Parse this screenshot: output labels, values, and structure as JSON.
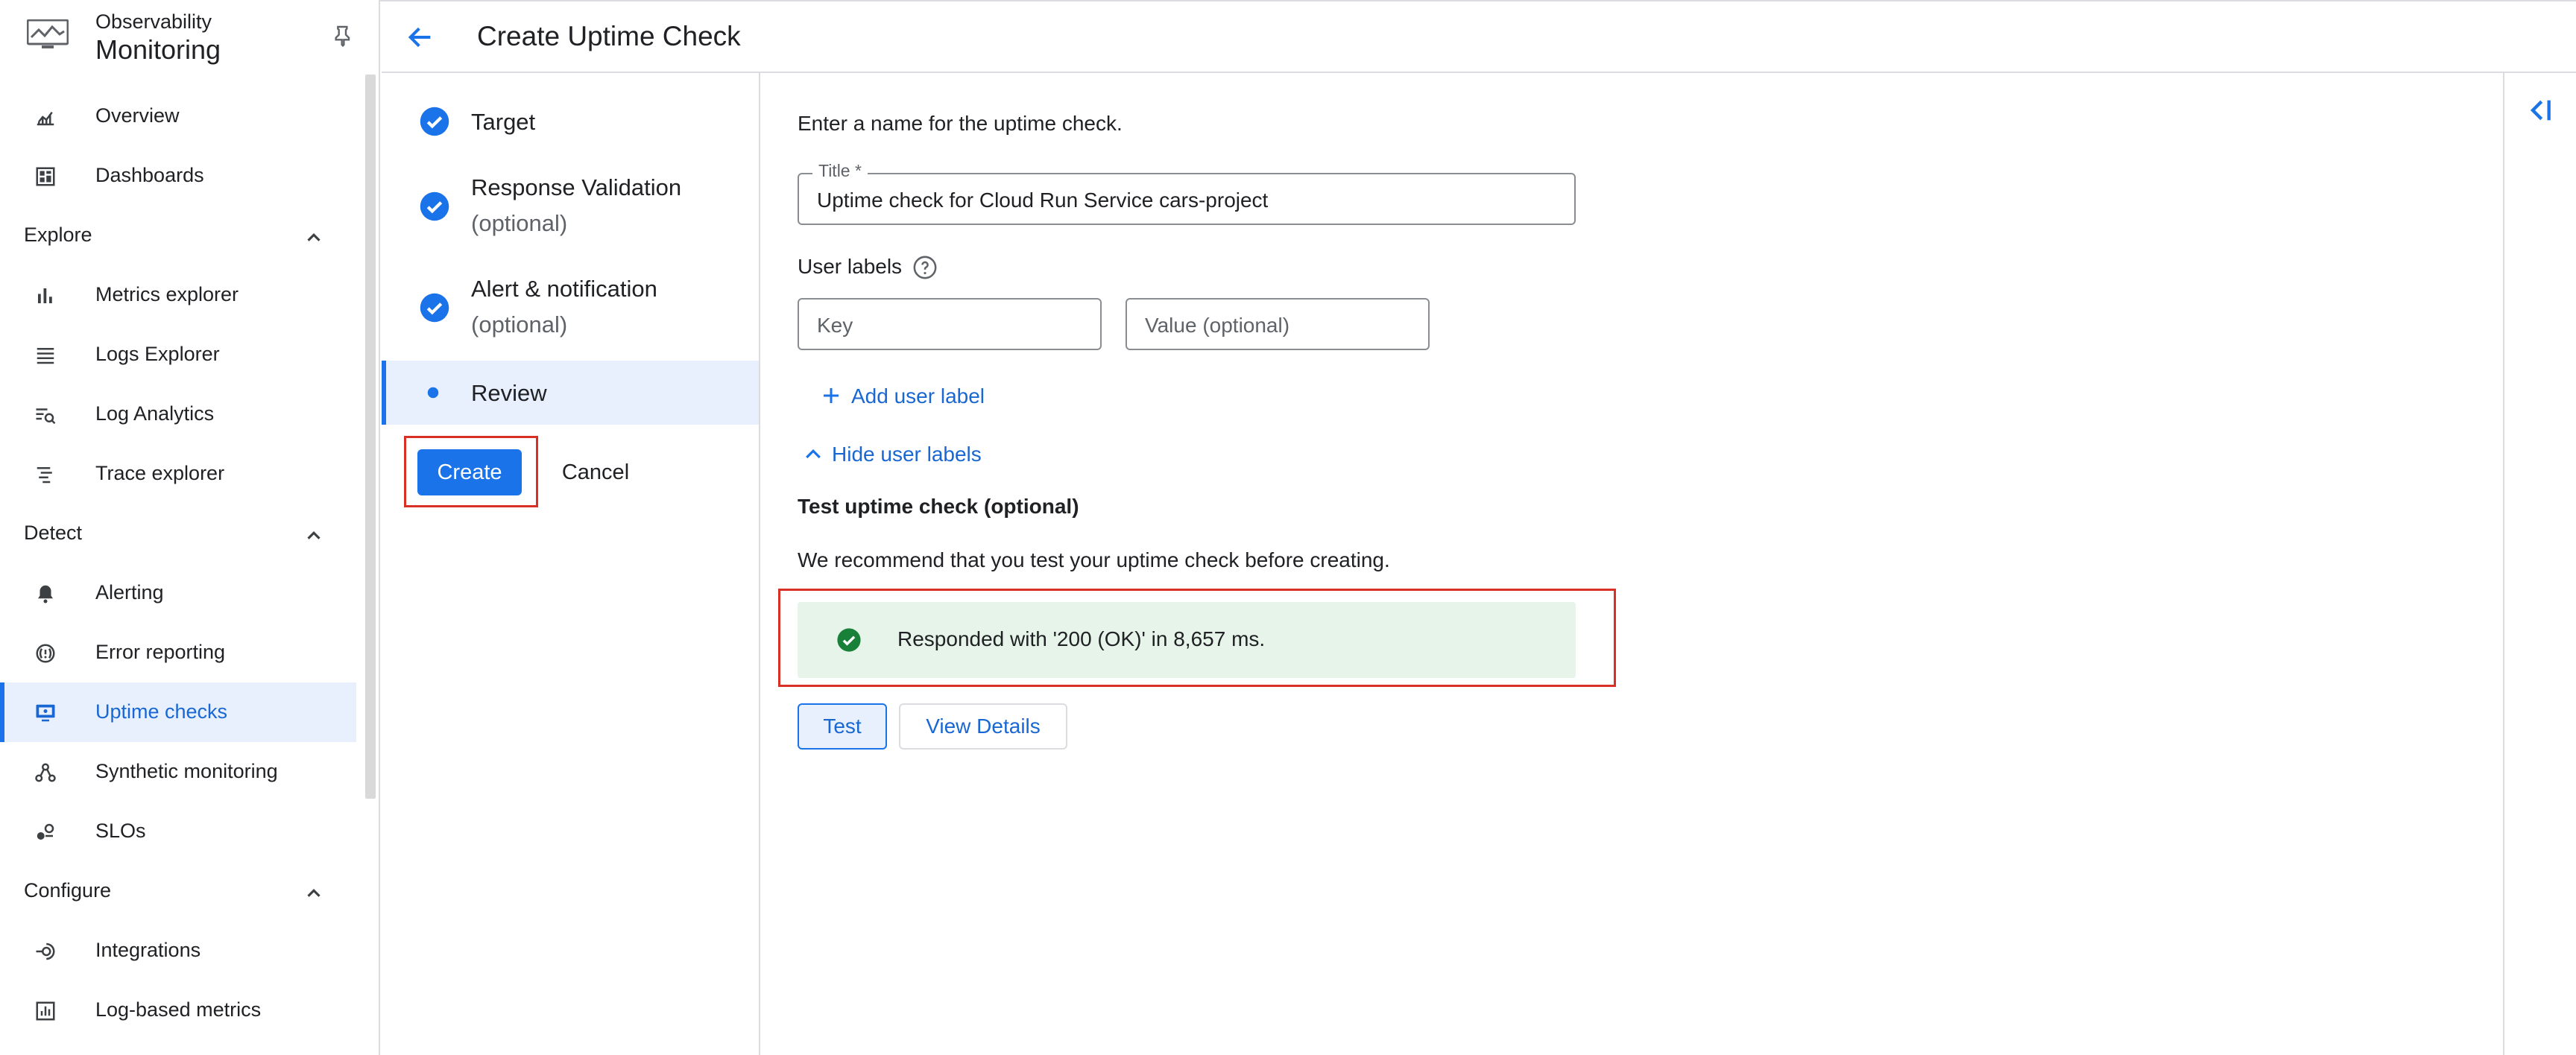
{
  "sidebar": {
    "product_overline": "Observability",
    "product_name": "Monitoring",
    "items_top": [
      {
        "label": "Overview",
        "icon": "chart-line-icon"
      },
      {
        "label": "Dashboards",
        "icon": "dashboard-icon"
      }
    ],
    "sections": [
      {
        "label": "Explore",
        "expanded": true,
        "items": [
          {
            "label": "Metrics explorer",
            "icon": "bar-chart-icon"
          },
          {
            "label": "Logs Explorer",
            "icon": "list-icon"
          },
          {
            "label": "Log Analytics",
            "icon": "search-list-icon"
          },
          {
            "label": "Trace explorer",
            "icon": "trace-icon"
          }
        ]
      },
      {
        "label": "Detect",
        "expanded": true,
        "items": [
          {
            "label": "Alerting",
            "icon": "bell-icon"
          },
          {
            "label": "Error reporting",
            "icon": "error-reporting-icon"
          },
          {
            "label": "Uptime checks",
            "icon": "monitor-icon",
            "active": true
          },
          {
            "label": "Synthetic monitoring",
            "icon": "synthetic-icon"
          },
          {
            "label": "SLOs",
            "icon": "slo-icon"
          }
        ]
      },
      {
        "label": "Configure",
        "expanded": true,
        "items": [
          {
            "label": "Integrations",
            "icon": "integrations-icon"
          },
          {
            "label": "Log-based metrics",
            "icon": "log-metrics-icon"
          }
        ]
      }
    ]
  },
  "header": {
    "title": "Create Uptime Check"
  },
  "stepper": {
    "steps": [
      {
        "label": "Target",
        "sub": "",
        "status": "complete"
      },
      {
        "label": "Response Validation",
        "sub": "(optional)",
        "status": "complete"
      },
      {
        "label": "Alert & notification",
        "sub": "(optional)",
        "status": "complete"
      },
      {
        "label": "Review",
        "sub": "",
        "status": "current"
      }
    ],
    "create_label": "Create",
    "cancel_label": "Cancel"
  },
  "form": {
    "intro": "Enter a name for the uptime check.",
    "title_label": "Title *",
    "title_value": "Uptime check for Cloud Run Service cars-project",
    "user_labels_heading": "User labels",
    "key_placeholder": "Key",
    "value_placeholder": "Value (optional)",
    "add_label": "Add user label",
    "hide_labels": "Hide user labels",
    "test_heading": "Test uptime check (optional)",
    "recommend": "We recommend that you test your uptime check before creating.",
    "result": "Responded with '200 (OK)' in 8,657 ms.",
    "test_button": "Test",
    "view_details_button": "View Details"
  },
  "colors": {
    "accent": "#1a73e8",
    "highlight": "#d93025",
    "success_bg": "#e6f4ea",
    "success_icon": "#188038"
  }
}
